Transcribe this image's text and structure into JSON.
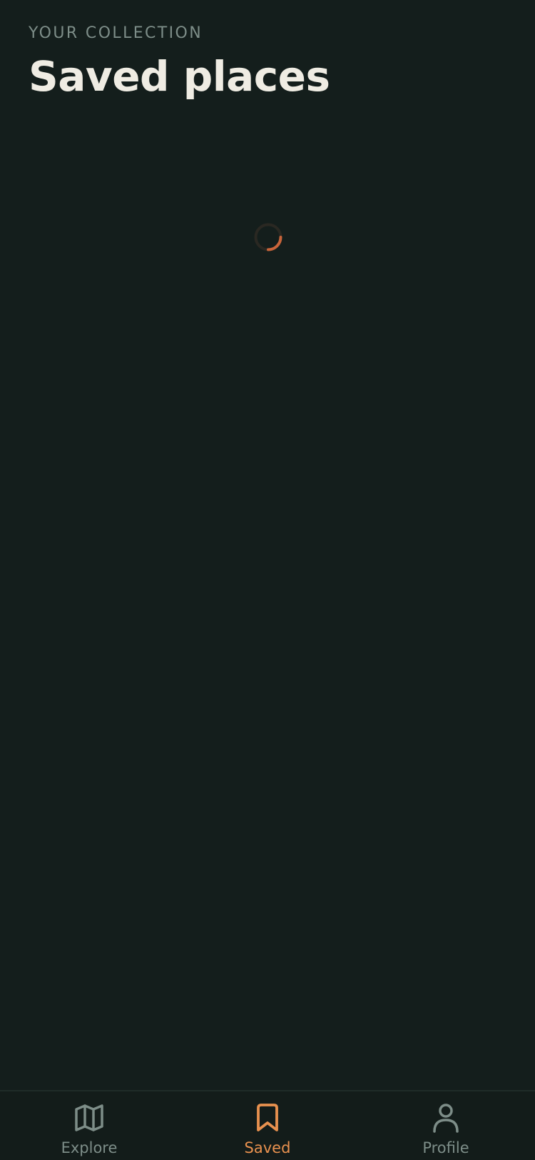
{
  "header": {
    "eyebrow": "YOUR COLLECTION",
    "title": "Saved places"
  },
  "loading": {
    "icon": "loading-spinner-icon",
    "track_color": "#2a2822",
    "accent_color": "#c8643a"
  },
  "tabbar": {
    "active_tab": "Saved",
    "active_color": "#e8914f",
    "inactive_color": "#7d8d88",
    "tabs": [
      {
        "label": "Explore",
        "icon": "map-icon"
      },
      {
        "label": "Saved",
        "icon": "bookmark-icon"
      },
      {
        "label": "Profile",
        "icon": "person-icon"
      }
    ]
  }
}
